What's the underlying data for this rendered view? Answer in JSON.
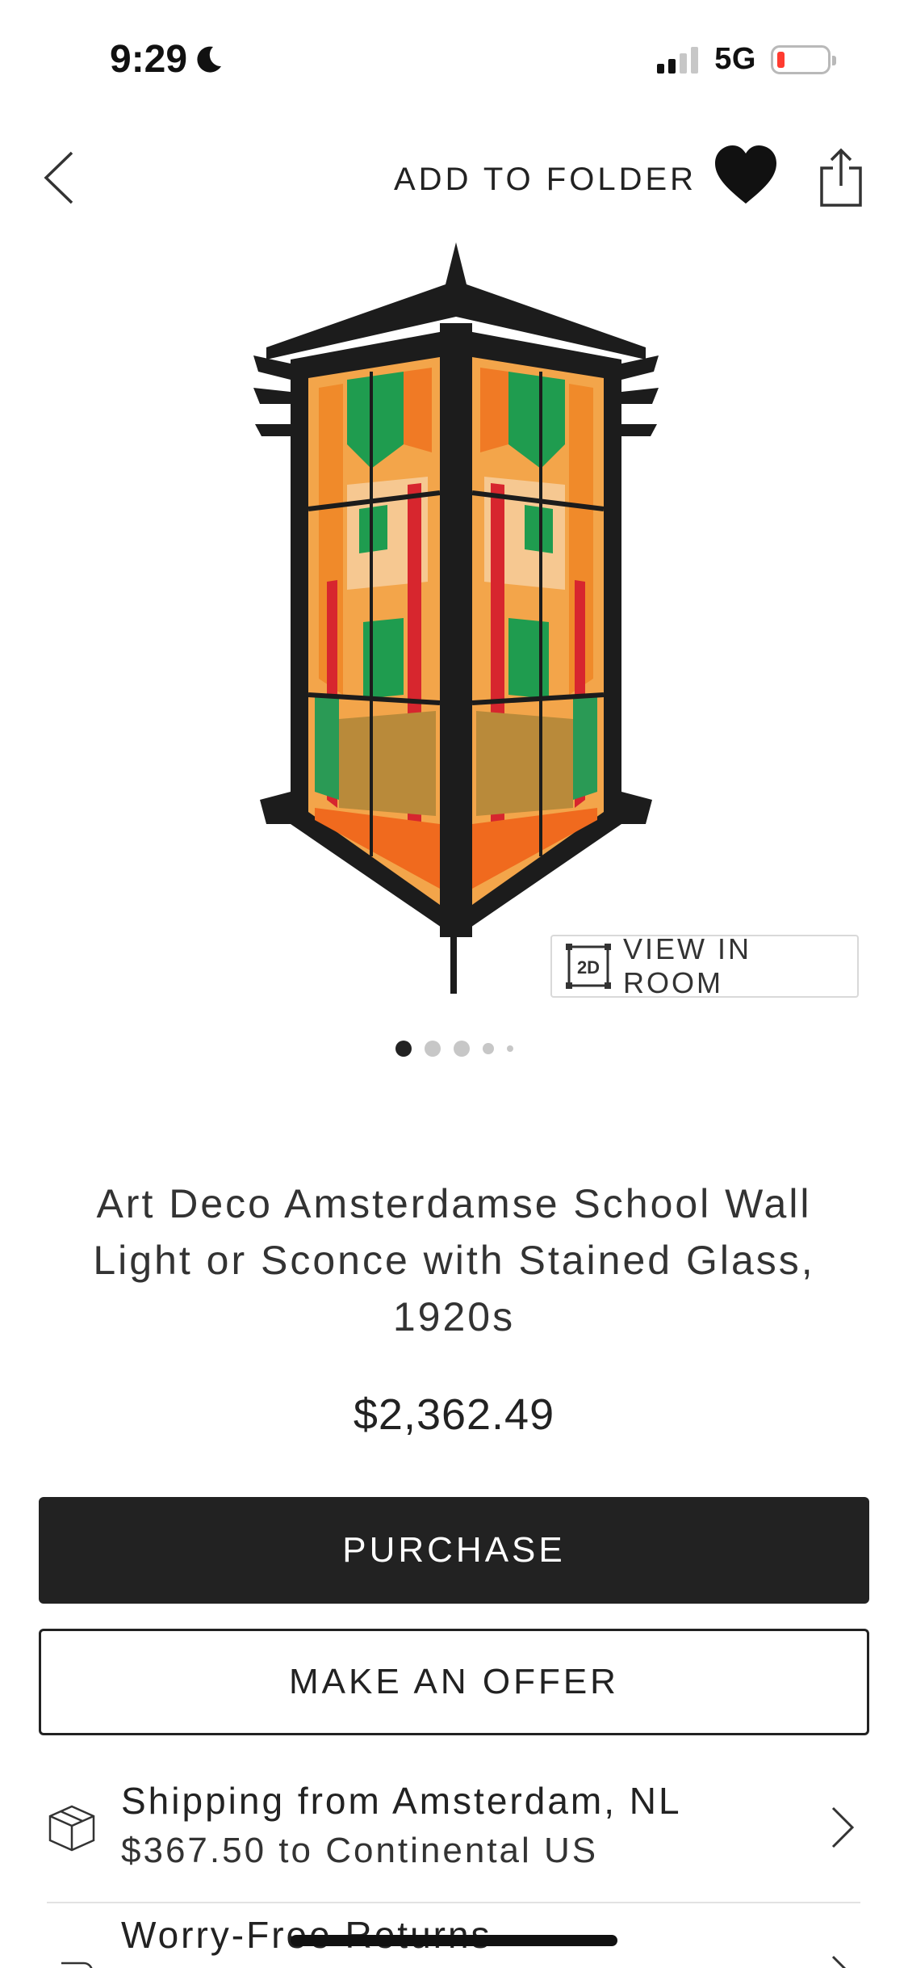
{
  "status_bar": {
    "time": "9:29",
    "network": "5G",
    "icons": [
      "moon-icon",
      "signal-icon",
      "battery-icon"
    ],
    "battery_color": "#ff3b30"
  },
  "nav": {
    "back_icon": "chevron-left-icon",
    "add_to_folder": "ADD TO FOLDER",
    "favorite_icon": "heart-icon",
    "share_icon": "share-icon"
  },
  "gallery": {
    "view_in_room_label": "VIEW IN ROOM",
    "view_in_room_badge": "2D",
    "dots_count": 5,
    "active_index": 0
  },
  "product": {
    "title": "Art Deco Amsterdamse School Wall Light or Sconce with Stained Glass, 1920s",
    "price": "$2,362.49"
  },
  "actions": {
    "purchase_label": "PURCHASE",
    "offer_label": "MAKE AN OFFER"
  },
  "shipping": {
    "line1": "Shipping from Amsterdam, NL",
    "line2": "$367.50 to Continental US",
    "icon": "package-icon"
  },
  "returns": {
    "line1": "Worry-Free Returns",
    "icon": "return-icon"
  },
  "colors": {
    "dark": "#222222",
    "divider": "#e2e2e2",
    "dot_inactive": "#c7c7c7"
  }
}
